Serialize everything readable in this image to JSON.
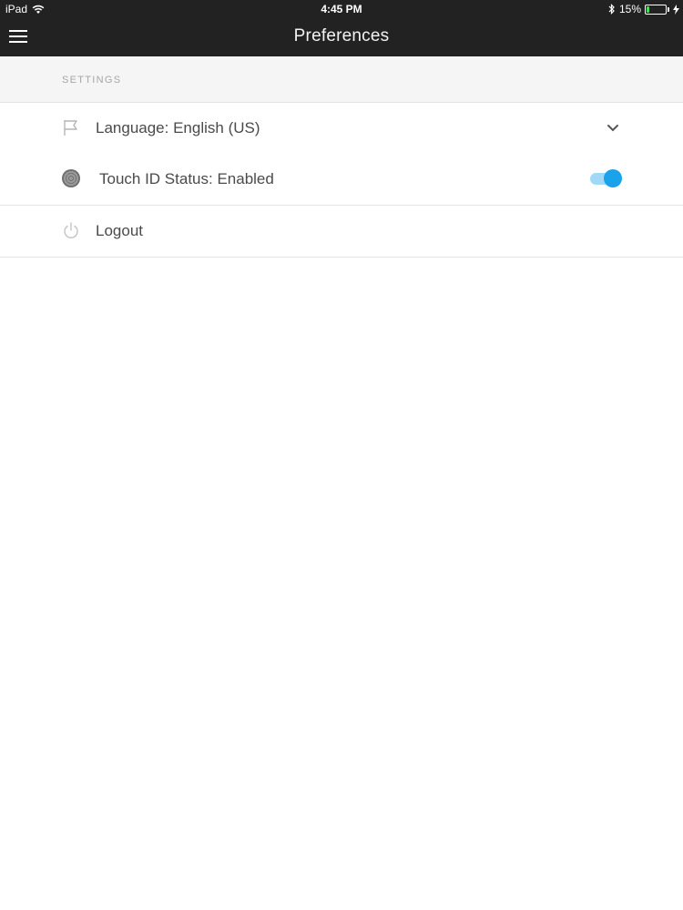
{
  "status_bar": {
    "device": "iPad",
    "time": "4:45 PM",
    "battery_text": "15%",
    "battery_level": 0.15,
    "battery_color": "#4cd964"
  },
  "nav": {
    "title": "Preferences",
    "menu_icon": "hamburger-icon"
  },
  "section": {
    "label": "SETTINGS"
  },
  "settings": {
    "language": {
      "label": "Language: English (US)",
      "icon": "flag-icon"
    },
    "touch_id": {
      "label": "Touch ID Status: Enabled",
      "icon": "fingerprint-icon",
      "enabled": true
    },
    "logout": {
      "label": "Logout",
      "icon": "power-icon"
    }
  },
  "colors": {
    "header_bg": "#222222",
    "accent": "#1aa2ea",
    "accent_light": "#9fd9f6"
  }
}
